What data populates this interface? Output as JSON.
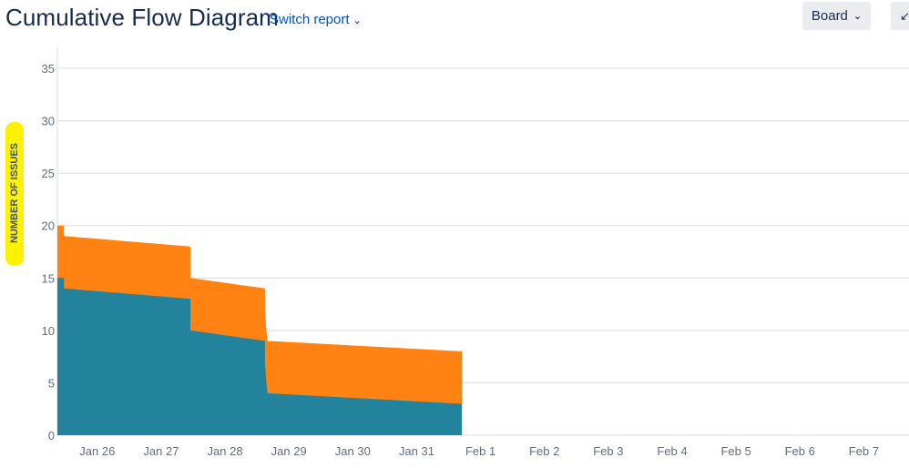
{
  "header": {
    "title": "Cumulative Flow Diagram",
    "switch_label": "Switch report",
    "board_label": "Board"
  },
  "colors": {
    "done": "#23839c",
    "in_progress": "#ff8212",
    "grid": "#dcdcdc",
    "highlight": "#fff200"
  },
  "chart_data": {
    "type": "area",
    "ylabel": "NUMBER OF ISSUES",
    "xlabel": "",
    "ylim": [
      0,
      37
    ],
    "yticks": [
      0,
      5,
      10,
      15,
      20,
      25,
      30,
      35
    ],
    "xlim": [
      "2024-01-25T09:00",
      "2024-02-07T17:00"
    ],
    "xtick_labels": [
      "Jan 26",
      "Jan 27",
      "Jan 28",
      "Jan 29",
      "Jan 30",
      "Jan 31",
      "Feb 1",
      "Feb 2",
      "Feb 3",
      "Feb 4",
      "Feb 5",
      "Feb 6",
      "Feb 7"
    ],
    "xtick_dates": [
      "2024-01-26",
      "2024-01-27",
      "2024-01-28",
      "2024-01-29",
      "2024-01-30",
      "2024-01-31",
      "2024-02-01",
      "2024-02-02",
      "2024-02-03",
      "2024-02-04",
      "2024-02-05",
      "2024-02-06",
      "2024-02-07"
    ],
    "series": [
      {
        "x": [
          "2024-01-25T09:00",
          "2024-01-25T11:30",
          "2024-01-25T11:30",
          "2024-01-27T11:00",
          "2024-01-27T11:00",
          "2024-01-28T15:00",
          "2024-01-28T15:00",
          "2024-01-28T15:30",
          "2024-01-28T16:00",
          "2024-01-31T17:00"
        ],
        "values": [
          15,
          15,
          14,
          13,
          10,
          9,
          7,
          5,
          4,
          3
        ]
      },
      {
        "x": [
          "2024-01-25T09:00",
          "2024-01-25T11:30",
          "2024-01-25T11:30",
          "2024-01-27T11:00",
          "2024-01-27T11:00",
          "2024-01-28T15:00",
          "2024-01-28T15:00",
          "2024-01-28T15:30",
          "2024-01-28T16:00",
          "2024-01-31T17:00"
        ],
        "values": [
          20,
          20,
          19,
          18,
          15,
          14,
          12,
          10,
          9,
          8
        ]
      }
    ]
  }
}
